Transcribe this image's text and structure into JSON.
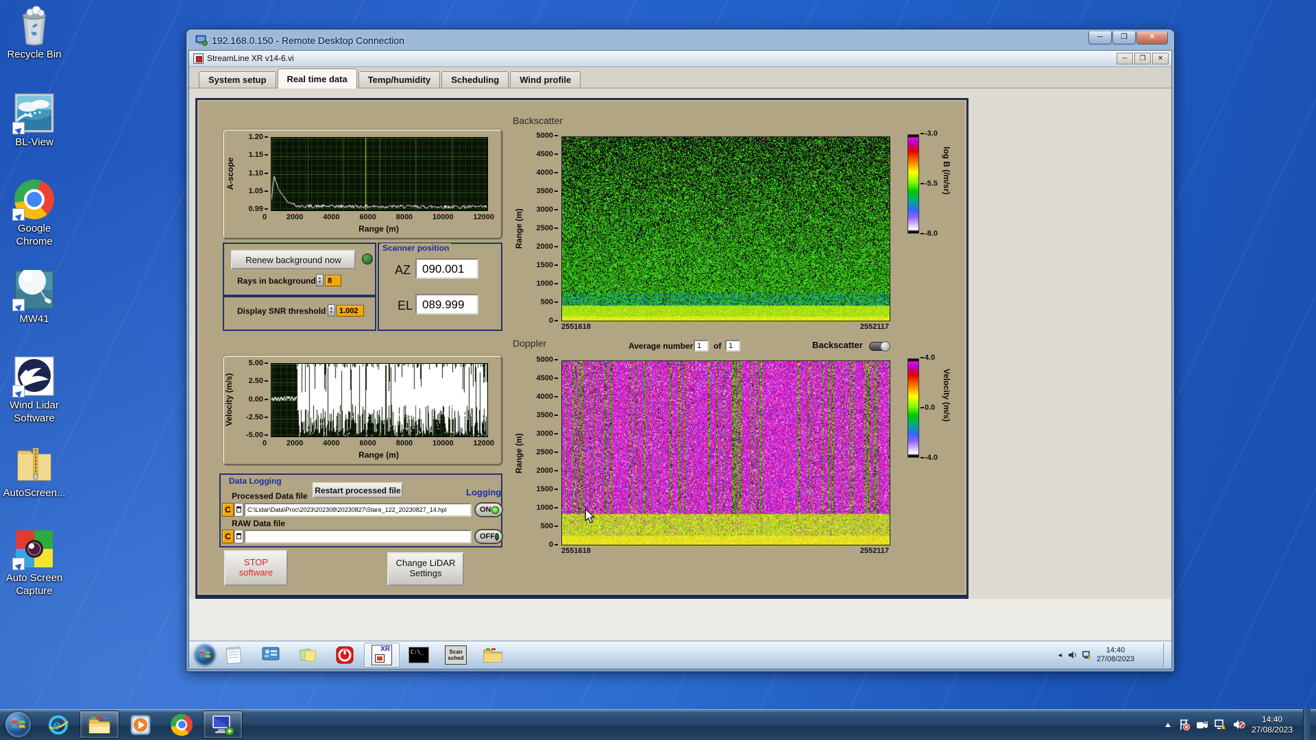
{
  "desktop": {
    "icons": [
      {
        "label": "Recycle Bin"
      },
      {
        "label": "BL-View"
      },
      {
        "label": "Google Chrome"
      },
      {
        "label": "MW41"
      },
      {
        "label": "Wind Lidar Software"
      },
      {
        "label": "AutoScreen..."
      },
      {
        "label": "Auto Screen Capture"
      }
    ]
  },
  "rdp_window": {
    "title": "192.168.0.150 - Remote Desktop Connection"
  },
  "app_window": {
    "title": "StreamLine XR v14-6.vi",
    "tabs": [
      {
        "label": "System setup"
      },
      {
        "label": "Real time data"
      },
      {
        "label": "Temp/humidity"
      },
      {
        "label": "Scheduling"
      },
      {
        "label": "Wind profile"
      }
    ]
  },
  "glyphs": {
    "minimize": "─",
    "maximize": "❐",
    "close": "✕"
  },
  "scanner": {
    "renew_button": "Renew background now",
    "rays_label": "Rays in background",
    "rays_value": "8",
    "snr_label": "Display SNR threshold",
    "snr_value": "1.002",
    "panel_title": "Scanner position",
    "az_label": "AZ",
    "az_value": "090.001",
    "el_label": "EL",
    "el_value": "089.999"
  },
  "backscatter_header": {
    "title": "Backscatter"
  },
  "doppler_header": {
    "title": "Doppler",
    "average_label": "Average number",
    "avg_value_1": "1",
    "of_label": "of",
    "avg_value_2": "1",
    "toggle_label": "Backscatter"
  },
  "logging": {
    "frame_title": "Data Logging",
    "processed_label": "Processed Data file",
    "restart_button": "Restart processed file",
    "logging_label": "Logging",
    "drive": "C",
    "processed_path": "C:\\Lidar\\Data\\Proc\\2023\\202308\\20230827\\Stare_122_20230827_14.hpl",
    "raw_label": "RAW Data file",
    "raw_path": "",
    "on_label": "ON",
    "off_label": "OFF"
  },
  "actions": {
    "stop_line1": "STOP",
    "stop_line2": "software",
    "change_line1": "Change LiDAR",
    "change_line2": "Settings"
  },
  "session_taskbar": {
    "xr_text": "XR",
    "cmd_text": "C:\\_",
    "scan_line1": "Scan",
    "scan_line2": "sched",
    "clock_time": "14:40",
    "clock_date": "27/08/2023"
  },
  "taskbar": {
    "clock_time": "14:40",
    "clock_date": "27/08/2023"
  },
  "chart_data": [
    {
      "id": "ascope",
      "type": "line",
      "xlabel": "Range (m)",
      "ylabel": "A-scope",
      "xlim": [
        0,
        12000
      ],
      "ylim": [
        0.99,
        1.2
      ],
      "x_tick_labels": [
        "0",
        "2000",
        "4000",
        "6000",
        "8000",
        "10000",
        "12000"
      ],
      "y_tick_labels": [
        "1.20",
        "1.15",
        "1.10",
        "1.05",
        "0.99"
      ],
      "grid": true,
      "cursor_x": 5200,
      "series": [
        {
          "name": "A-scope",
          "keypoints": [
            [
              0,
              1.02
            ],
            [
              150,
              1.09
            ],
            [
              400,
              1.05
            ],
            [
              900,
              1.015
            ],
            [
              1500,
              1.002
            ],
            [
              12000,
              1.0
            ]
          ],
          "noise": 0.005
        }
      ]
    },
    {
      "id": "backscatter",
      "type": "heatmap",
      "title": "Backscatter",
      "ylabel": "Range (m)",
      "ylim": [
        0,
        5000
      ],
      "y_tick_labels": [
        "5000",
        "4500",
        "4000",
        "3500",
        "3000",
        "2500",
        "2000",
        "1500",
        "1000",
        "500",
        "0"
      ],
      "x_tick_labels": [
        "2551618",
        "2552117"
      ],
      "colorbar": {
        "label": "log B (/m/sr)",
        "tick_labels": [
          "-3.0",
          "-5.5",
          "-8.0"
        ],
        "range": [
          -3.0,
          -8.0
        ]
      },
      "description": "Green backscatter field with black speckle noise increasing with range; bright yellow-green aerosol layer below ~500 m"
    },
    {
      "id": "velocity",
      "type": "line",
      "xlabel": "Range (m)",
      "ylabel": "Velocity (m/s)",
      "xlim": [
        0,
        12000
      ],
      "ylim": [
        -5,
        5
      ],
      "x_tick_labels": [
        "0",
        "2000",
        "4000",
        "6000",
        "8000",
        "10000",
        "12000"
      ],
      "y_tick_labels": [
        "5.00",
        "2.50",
        "0.00",
        "-2.50",
        "-5.00"
      ],
      "grid": true,
      "series": [
        {
          "name": "Velocity",
          "description": "near 0 m/s below ~1400 m, saturated full-scale noise beyond"
        }
      ]
    },
    {
      "id": "doppler",
      "type": "heatmap",
      "title": "Doppler",
      "ylabel": "Range (m)",
      "ylim": [
        0,
        5000
      ],
      "y_tick_labels": [
        "5000",
        "4500",
        "4000",
        "3500",
        "3000",
        "2500",
        "2000",
        "1500",
        "1000",
        "500",
        "0"
      ],
      "x_tick_labels": [
        "2551618",
        "2552117"
      ],
      "colorbar": {
        "label": "Velocity (m/s)",
        "tick_labels": [
          "4.0",
          "0.0",
          "-4.0"
        ],
        "range": [
          4.0,
          -4.0
        ]
      },
      "description": "Magenta velocity noise aloft with vertical green streaks; coherent yellow-green velocities below ~1000 m"
    }
  ]
}
